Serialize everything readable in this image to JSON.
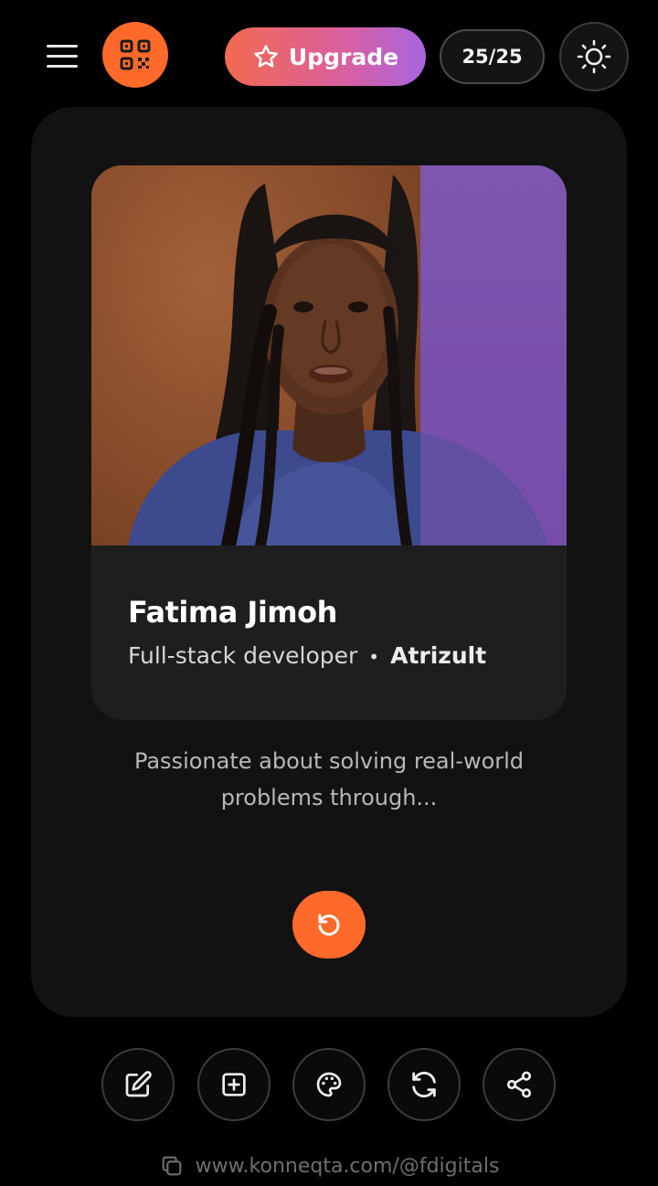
{
  "header": {
    "menu_icon": "hamburger-menu-icon",
    "qr_icon": "qr-code-icon",
    "upgrade_label": "Upgrade",
    "upgrade_icon": "star-outline-icon",
    "usage_count": "25/25",
    "theme_icon": "sun-icon"
  },
  "profile": {
    "name": "Fatima Jimoh",
    "role": "Full-stack developer",
    "separator": "•",
    "company": "Atrizult",
    "bio": "Passionate about solving real-world problems through..."
  },
  "card_actions": {
    "reset_icon": "rotate-ccw-icon"
  },
  "bottom_actions": [
    {
      "icon": "edit-icon"
    },
    {
      "icon": "add-square-icon"
    },
    {
      "icon": "palette-icon"
    },
    {
      "icon": "sync-icon"
    },
    {
      "icon": "share-icon"
    }
  ],
  "footer": {
    "copy_icon": "copy-icon",
    "url": "www.konneqta.com/@fdigitals"
  },
  "colors": {
    "accent": "#ff6a2b",
    "background": "#000000",
    "card": "#121212",
    "upgrade_gradient_start": "#f36a4f",
    "upgrade_gradient_end": "#a866e0"
  }
}
